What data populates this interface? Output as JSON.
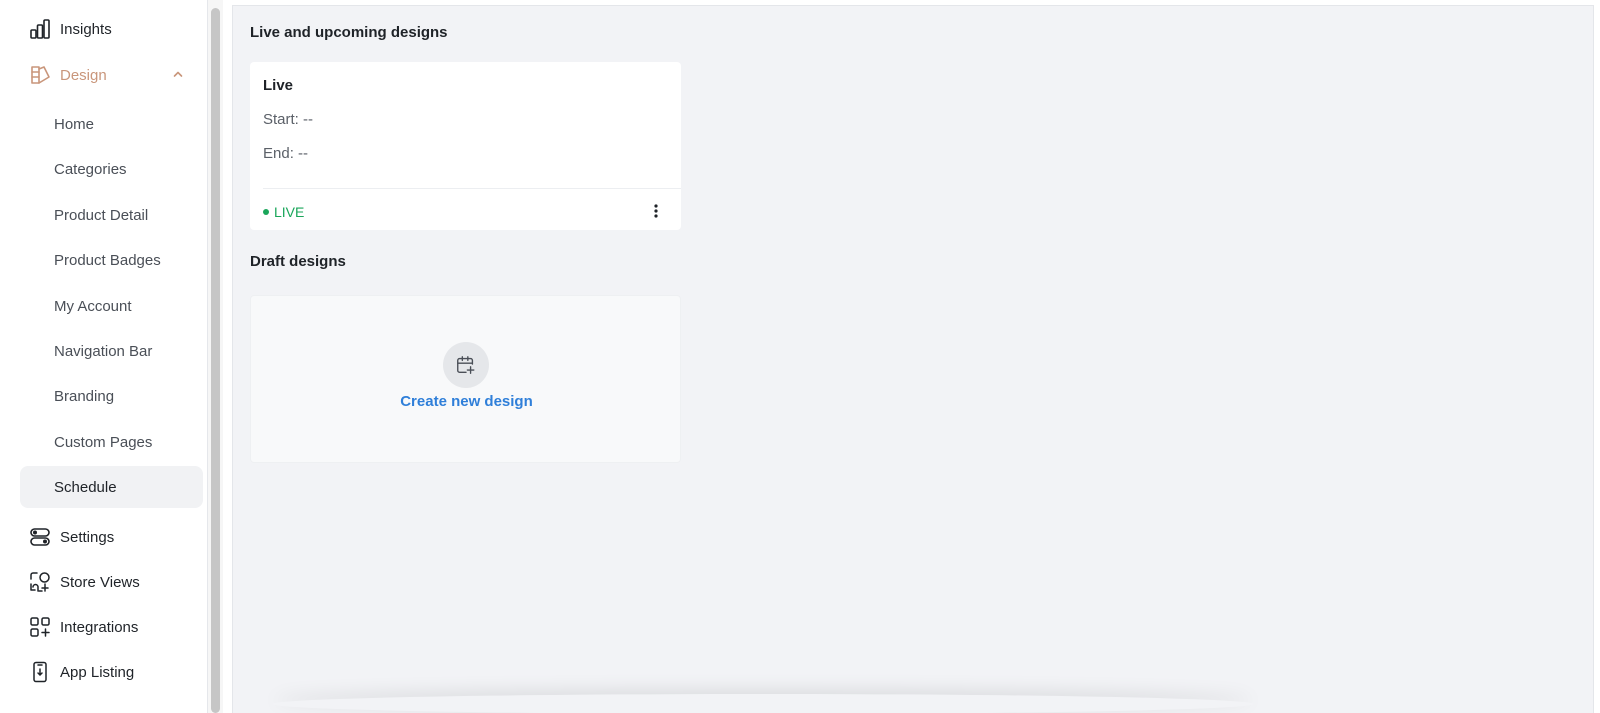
{
  "sidebar": {
    "items": [
      {
        "label": "Insights",
        "icon": "bar-chart-icon"
      },
      {
        "label": "Design",
        "icon": "palette-icon",
        "expanded": true,
        "accent": "#c9967b"
      },
      {
        "label": "Settings",
        "icon": "toggles-icon"
      },
      {
        "label": "Store Views",
        "icon": "store-views-icon"
      },
      {
        "label": "Integrations",
        "icon": "grid-plus-icon"
      },
      {
        "label": "App Listing",
        "icon": "phone-icon"
      }
    ],
    "design_subitems": [
      {
        "label": "Home"
      },
      {
        "label": "Categories"
      },
      {
        "label": "Product Detail"
      },
      {
        "label": "Product Badges"
      },
      {
        "label": "My Account"
      },
      {
        "label": "Navigation Bar"
      },
      {
        "label": "Branding"
      },
      {
        "label": "Custom Pages"
      },
      {
        "label": "Schedule",
        "active": true
      }
    ]
  },
  "main": {
    "live_section_title": "Live and upcoming designs",
    "live_card": {
      "title": "Live",
      "start": "Start: --",
      "end": "End: --",
      "status": "LIVE",
      "status_color": "#1aa65a"
    },
    "draft_section_title": "Draft designs",
    "draft_card": {
      "create_label": "Create new design",
      "link_color": "#2f7fd9"
    }
  }
}
